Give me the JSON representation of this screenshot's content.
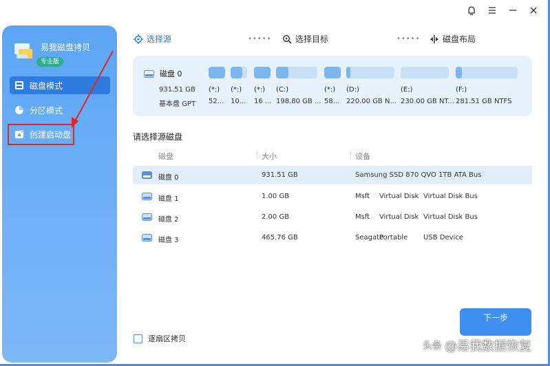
{
  "app": {
    "title": "易我磁盘拷贝",
    "badge": "专业版"
  },
  "window_controls": [
    "skin-icon",
    "menu-icon",
    "minimize-icon",
    "close-icon"
  ],
  "sidebar": {
    "items": [
      {
        "label": "磁盘模式",
        "icon": "disk-icon",
        "active": true
      },
      {
        "label": "分区模式",
        "icon": "pie-icon",
        "active": false
      },
      {
        "label": "创建启动盘",
        "icon": "boot-disk-icon",
        "active": false
      }
    ]
  },
  "steps": {
    "source": "选择源",
    "target": "选择目标",
    "layout": "磁盘布局",
    "dots": "•••••"
  },
  "disk_card": {
    "name": "磁盘 0",
    "size": "931.51 GB",
    "type": "基本盘 GPT",
    "partitions": [
      {
        "label": "(*:)",
        "info": "52...",
        "fill": 1.0
      },
      {
        "label": "(*:)",
        "info": "10...",
        "fill": 0.7
      },
      {
        "label": "(*:)",
        "info": "16 ...",
        "fill": 1.0
      },
      {
        "label": "(C:)",
        "info": "198.80 GB ...",
        "fill": 0.3
      },
      {
        "label": "(*:)",
        "info": "58...",
        "fill": 1.0
      },
      {
        "label": "(D:)",
        "info": "220.00 GB N...",
        "fill": 0.05
      },
      {
        "label": "(E:)",
        "info": "230.00 GB NT...",
        "fill": 0.0
      },
      {
        "label": "(F:)",
        "info": "281.51 GB NTFS",
        "fill": 0.1
      }
    ]
  },
  "table": {
    "title": "请选择源磁盘",
    "headers": {
      "disk": "磁盘",
      "size": "大小",
      "device": "设备"
    },
    "rows": [
      {
        "disk": "磁盘 0",
        "size": "931.51 GB",
        "dev1": "Samsung SSD 870 QVO 1TB ATA Bus",
        "dev2": "",
        "dev3": "",
        "selected": true
      },
      {
        "disk": "磁盘 1",
        "size": "1.00 GB",
        "dev1": "Msft",
        "dev2": "Virtual Disk",
        "dev3": "Virtual Disk Bus",
        "selected": false
      },
      {
        "disk": "磁盘 2",
        "size": "2.00 GB",
        "dev1": "Msft",
        "dev2": "Virtual Disk",
        "dev3": "Virtual Disk Bus",
        "selected": false
      },
      {
        "disk": "磁盘 3",
        "size": "465.76 GB",
        "dev1": "Seagate",
        "dev2": "Portable",
        "dev3": "USB Device",
        "selected": false
      }
    ]
  },
  "sector_copy_label": "逐扇区拷贝",
  "next_button": "下一步",
  "watermark": {
    "logo": "头条",
    "text": "@易我数据恢复"
  },
  "colors": {
    "accent": "#3f8ff0",
    "sidebar": "#5ca6f5",
    "highlight": "#e8221e"
  }
}
